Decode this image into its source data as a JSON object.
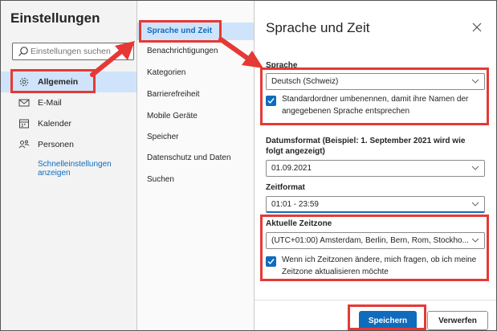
{
  "sidebar": {
    "title": "Einstellungen",
    "search_placeholder": "Einstellungen suchen",
    "items": [
      {
        "label": "Allgemein",
        "icon": "gear-icon"
      },
      {
        "label": "E-Mail",
        "icon": "mail-icon"
      },
      {
        "label": "Kalender",
        "icon": "calendar-icon"
      },
      {
        "label": "Personen",
        "icon": "people-icon"
      }
    ],
    "quick_settings": "Schnelleinstellungen anzeigen"
  },
  "subnav": {
    "items": [
      "Sprache und Zeit",
      "Benachrichtigungen",
      "Kategorien",
      "Barrierefreiheit",
      "Mobile Geräte",
      "Speicher",
      "Datenschutz und Daten",
      "Suchen"
    ]
  },
  "panel": {
    "title": "Sprache und Zeit",
    "language_label": "Sprache",
    "language_value": "Deutsch (Schweiz)",
    "rename_folders_text": "Standardordner umbenennen, damit ihre Namen der angegebenen Sprache entsprechen",
    "date_format_label": "Datumsformat (Beispiel: 1. September 2021 wird wie folgt angezeigt)",
    "date_format_value": "01.09.2021",
    "time_format_label": "Zeitformat",
    "time_format_value": "01:01 - 23:59",
    "timezone_label": "Aktuelle Zeitzone",
    "timezone_value": "(UTC+01:00) Amsterdam, Berlin, Bern, Rom, Stockho...",
    "timezone_prompt_text": "Wenn ich Zeitzonen ändere, mich fragen, ob ich meine Zeitzone aktualisieren möchte",
    "save_label": "Speichern",
    "discard_label": "Verwerfen"
  },
  "colors": {
    "accent": "#0f6cbd",
    "selection": "#cfe4fa",
    "annotation": "#e53935"
  }
}
